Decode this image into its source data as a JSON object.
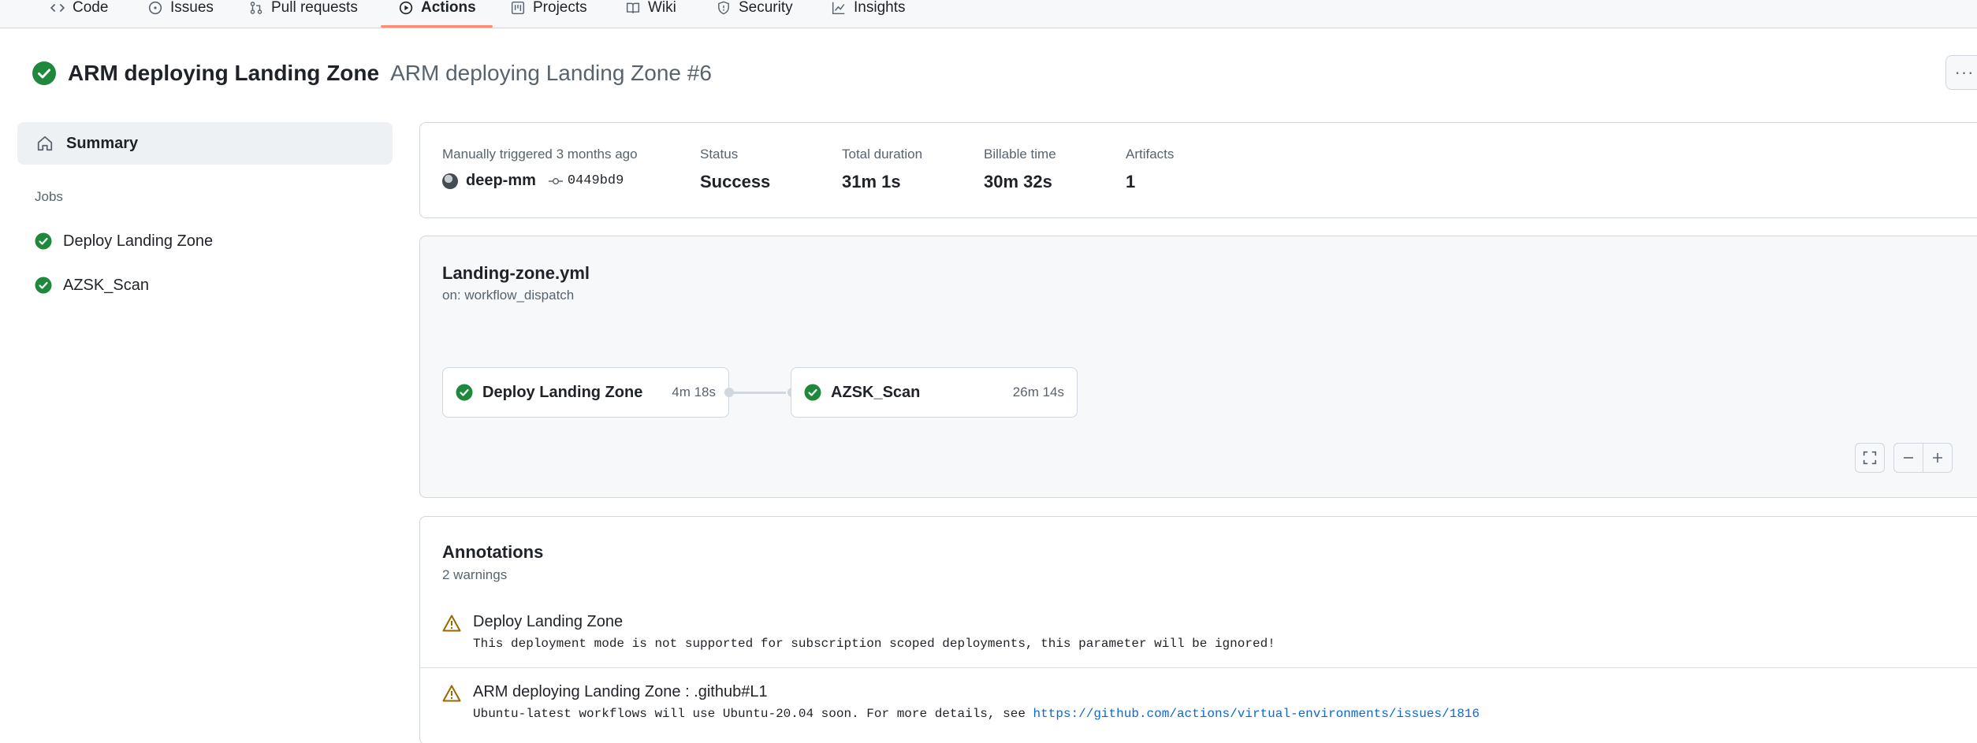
{
  "nav": {
    "tabs": [
      {
        "label": "Code"
      },
      {
        "label": "Issues"
      },
      {
        "label": "Pull requests"
      },
      {
        "label": "Actions"
      },
      {
        "label": "Projects"
      },
      {
        "label": "Wiki"
      },
      {
        "label": "Security"
      },
      {
        "label": "Insights"
      }
    ],
    "active": "Actions"
  },
  "run": {
    "workflow_name": "ARM deploying Landing Zone",
    "run_title": "ARM deploying Landing Zone #6",
    "more_label": "···"
  },
  "sidebar": {
    "summary_label": "Summary",
    "jobs_label": "Jobs",
    "jobs": [
      {
        "label": "Deploy Landing Zone"
      },
      {
        "label": "AZSK_Scan"
      }
    ]
  },
  "summary": {
    "trigger_label": "Manually triggered 3 months ago",
    "actor": "deep-mm",
    "commit": "0449bd9",
    "status_label": "Status",
    "status_value": "Success",
    "duration_label": "Total duration",
    "duration_value": "31m 1s",
    "billable_label": "Billable time",
    "billable_value": "30m 32s",
    "artifacts_label": "Artifacts",
    "artifacts_value": "1"
  },
  "workflow": {
    "file": "Landing-zone.yml",
    "trigger": "on: workflow_dispatch",
    "jobs": [
      {
        "name": "Deploy Landing Zone",
        "duration": "4m 18s"
      },
      {
        "name": "AZSK_Scan",
        "duration": "26m 14s"
      }
    ]
  },
  "annotations": {
    "title": "Annotations",
    "count": "2 warnings",
    "items": [
      {
        "job": "Deploy Landing Zone",
        "suffix": "",
        "message": "This deployment mode is not supported for subscription scoped deployments, this parameter will be ignored!",
        "link": ""
      },
      {
        "job": "ARM deploying Landing Zone",
        "suffix": " : .github#L1",
        "message": "Ubuntu-latest workflows will use Ubuntu-20.04 soon. For more details, see ",
        "link": "https://github.com/actions/virtual-environments/issues/1816"
      }
    ]
  },
  "colors": {
    "success": "#1f883d",
    "warning": "#9a6700",
    "active_tab_underline": "#fd8c73",
    "link": "#0969da"
  }
}
